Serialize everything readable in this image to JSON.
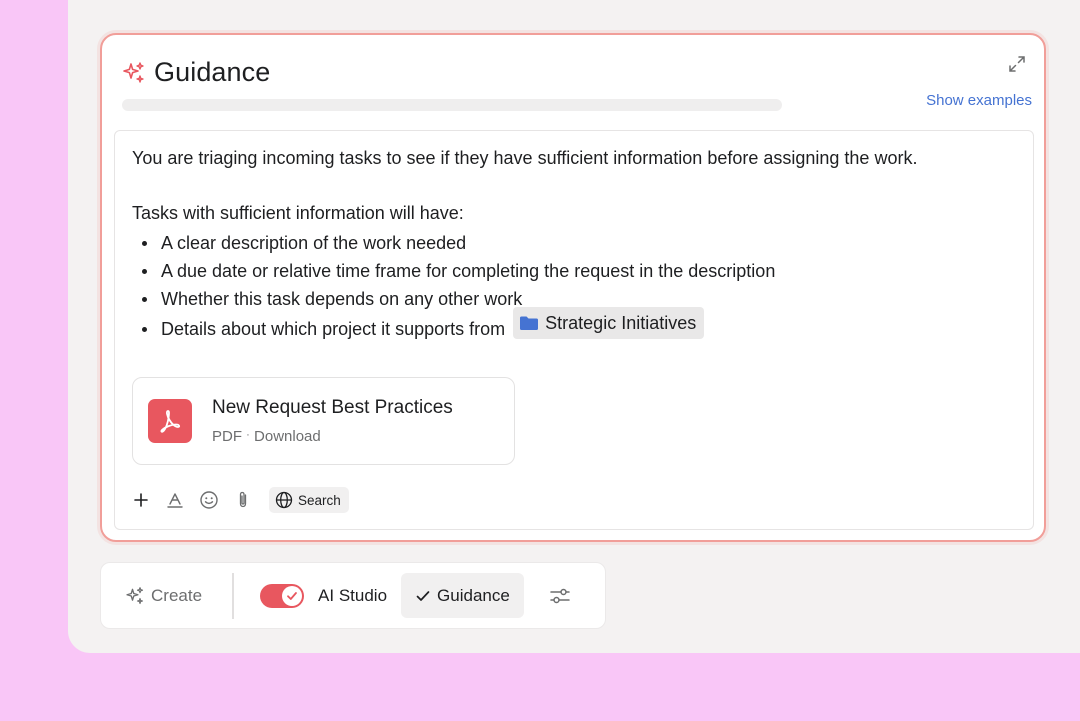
{
  "card": {
    "title": "Guidance",
    "show_examples": "Show examples",
    "sparkle_icon": "sparkle-icon",
    "expand_icon": "expand-icon",
    "accent": "#e8575f"
  },
  "editor": {
    "intro": "You are triaging incoming tasks to see if they have sufficient information before assigning the work.",
    "subhead": "Tasks with sufficient information will have:",
    "bullets": [
      "A clear description of the work needed",
      "A due date or relative time frame for completing the request in the description",
      "Whether this task depends on any other work",
      "Details about which project it supports from"
    ],
    "chip_label": "Strategic Initiatives",
    "attachment": {
      "name": "New Request Best Practices",
      "type": "PDF",
      "action": "Download"
    },
    "toolbar": {
      "search_label": "Search"
    }
  },
  "bottom_bar": {
    "create_label": "Create",
    "ai_studio_label": "AI Studio",
    "ai_studio_enabled": true,
    "guidance_label": "Guidance"
  }
}
